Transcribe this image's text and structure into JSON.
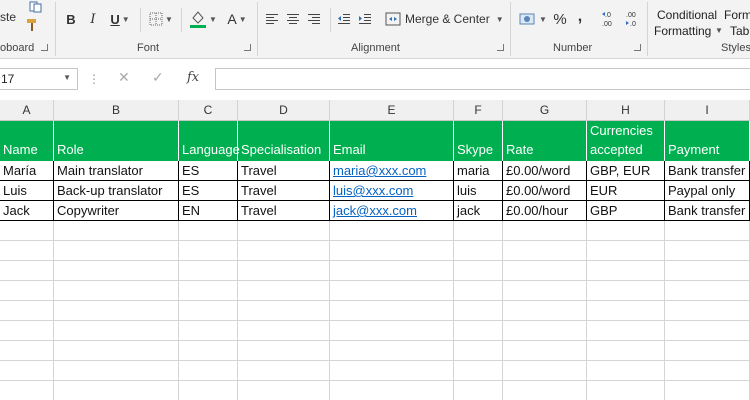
{
  "ribbon": {
    "clipboard": {
      "paste_label": "ste",
      "group_label": "oboard"
    },
    "font": {
      "bold": "B",
      "italic": "I",
      "underline": "U",
      "font_color_glyph": "A",
      "group_label": "Font"
    },
    "alignment": {
      "merge_label": "Merge & Center",
      "group_label": "Alignment"
    },
    "number": {
      "percent": "%",
      "comma": ",",
      "increase_decimal": ".00\n→.0",
      "group_label": "Number"
    },
    "styles": {
      "conditional_line1": "Conditional",
      "conditional_line2": "Formatting",
      "format_line1": "Form",
      "format_line2": "Tab",
      "group_label": "Styles"
    }
  },
  "formula_bar": {
    "name_box": "17",
    "fx": "fx",
    "formula": ""
  },
  "columns": [
    "A",
    "B",
    "C",
    "D",
    "E",
    "F",
    "G",
    "H",
    "I"
  ],
  "table": {
    "headers": [
      {
        "line1": "",
        "line2": "Name"
      },
      {
        "line1": "",
        "line2": "Role"
      },
      {
        "line1": "",
        "line2": "Language"
      },
      {
        "line1": "",
        "line2": "Specialisation"
      },
      {
        "line1": "",
        "line2": "Email"
      },
      {
        "line1": "",
        "line2": "Skype"
      },
      {
        "line1": "",
        "line2": "Rate"
      },
      {
        "line1": "Currencies",
        "line2": "accepted"
      },
      {
        "line1": "",
        "line2": "Payment"
      }
    ],
    "rows": [
      [
        "María",
        "Main translator",
        "ES",
        "Travel",
        "maria@xxx.com",
        "maria",
        "£0.00/word",
        "GBP, EUR",
        "Bank transfer"
      ],
      [
        "Luis",
        "Back-up translator",
        "ES",
        "Travel",
        "luis@xxx.com",
        "luis",
        "£0.00/word",
        "EUR",
        "Paypal only"
      ],
      [
        "Jack",
        "Copywriter",
        "EN",
        "Travel",
        "jack@xxx.com",
        "jack",
        "£0.00/hour",
        "GBP",
        "Bank transfer"
      ]
    ]
  },
  "colors": {
    "header_green": "#00b050",
    "link_blue": "#0563c1"
  }
}
